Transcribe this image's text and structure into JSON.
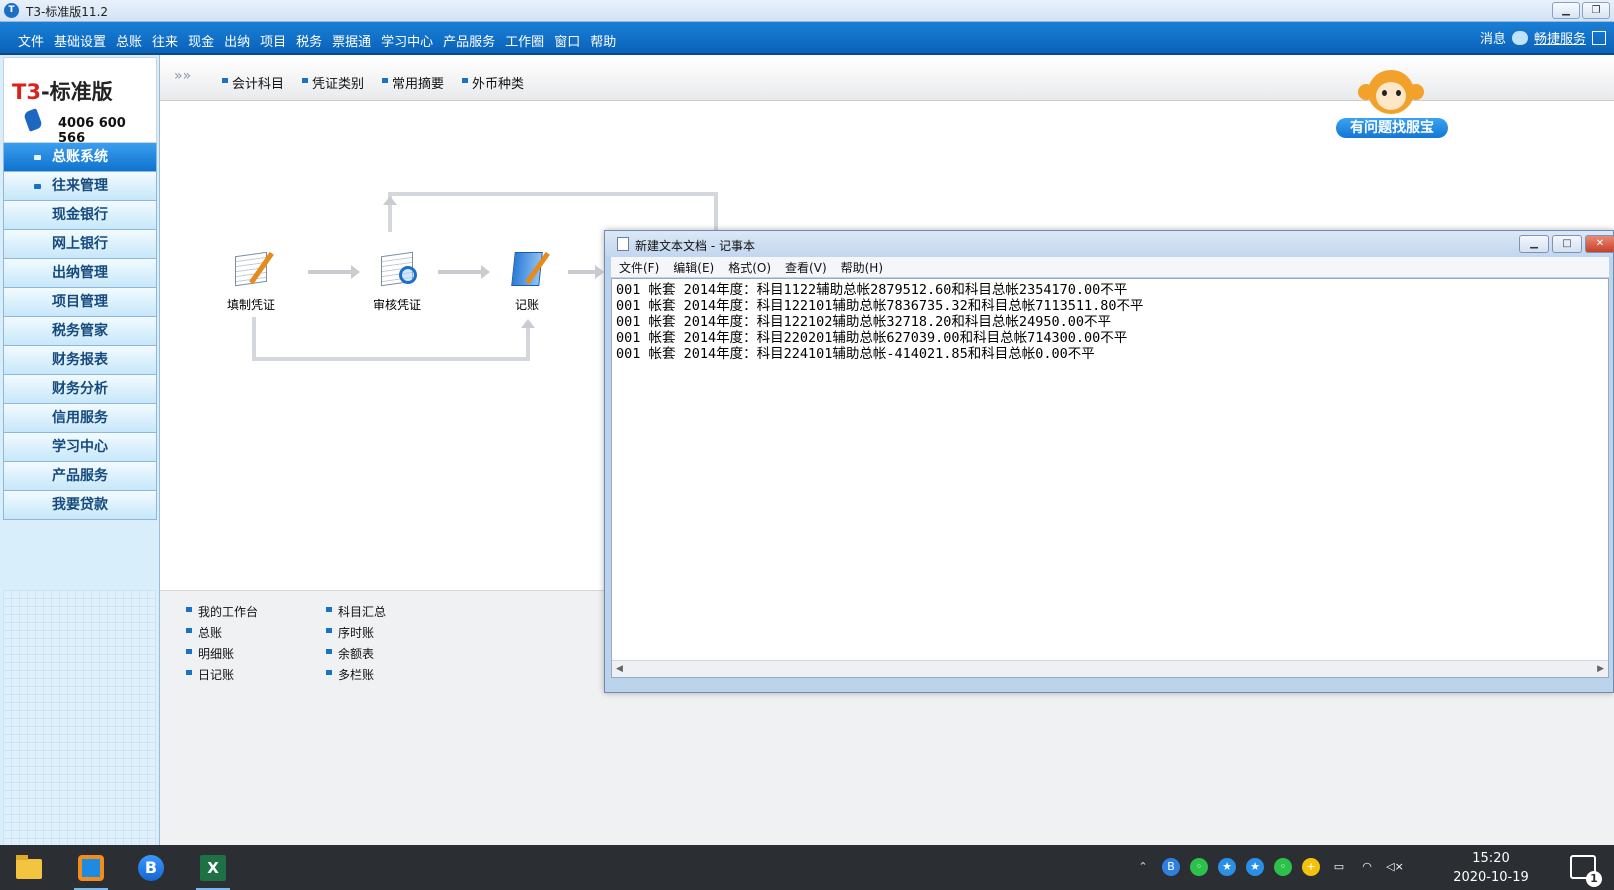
{
  "window": {
    "title": "T3-标准版11.2"
  },
  "menubar": {
    "items": [
      "文件",
      "基础设置",
      "总账",
      "往来",
      "现金",
      "出纳",
      "项目",
      "税务",
      "票据通",
      "学习中心",
      "产品服务",
      "工作圈",
      "窗口",
      "帮助"
    ],
    "messages": "消息",
    "quick_service": "畅捷服务"
  },
  "logo": {
    "brand_prefix": "T3",
    "brand_suffix": "-标准版",
    "phone": "4006 600 566"
  },
  "sidebar": {
    "items": [
      {
        "label": "总账系统",
        "active": true
      },
      {
        "label": "往来管理"
      },
      {
        "label": "现金银行"
      },
      {
        "label": "网上银行"
      },
      {
        "label": "出纳管理"
      },
      {
        "label": "项目管理"
      },
      {
        "label": "税务管家"
      },
      {
        "label": "财务报表"
      },
      {
        "label": "财务分析"
      },
      {
        "label": "信用服务"
      },
      {
        "label": "学习中心"
      },
      {
        "label": "产品服务"
      },
      {
        "label": "我要贷款"
      }
    ]
  },
  "toolbar": {
    "chevron": "»»",
    "links": [
      "会计科目",
      "凭证类别",
      "常用摘要",
      "外币种类"
    ]
  },
  "helper": {
    "label": "有问题找服宝"
  },
  "flow": {
    "nodes": [
      "填制凭证",
      "审核凭证",
      "记账"
    ]
  },
  "quicklinks": [
    "我的工作台",
    "科目汇总",
    "总账",
    "序时账",
    "明细账",
    "余额表",
    "日记账",
    "多栏账"
  ],
  "notepad": {
    "title": "新建文本文档 - 记事本",
    "menu": [
      "文件(F)",
      "编辑(E)",
      "格式(O)",
      "查看(V)",
      "帮助(H)"
    ],
    "lines": [
      "001 帐套 2014年度：科目1122辅助总帐2879512.60和科目总帐2354170.00不平",
      "001 帐套 2014年度：科目122101辅助总帐7836735.32和科目总帐7113511.80不平",
      "001 帐套 2014年度：科目122102辅助总帐32718.20和科目总帐24950.00不平",
      "001 帐套 2014年度：科目220201辅助总帐627039.00和科目总帐714300.00不平",
      "001 帐套 2014年度：科目224101辅助总帐-414021.85和科目总帐0.00不平"
    ]
  },
  "taskbar": {
    "time": "15:20",
    "date": "2020-10-19",
    "notification_count": "1",
    "excel_letter": "X",
    "browser_letter": "B"
  }
}
